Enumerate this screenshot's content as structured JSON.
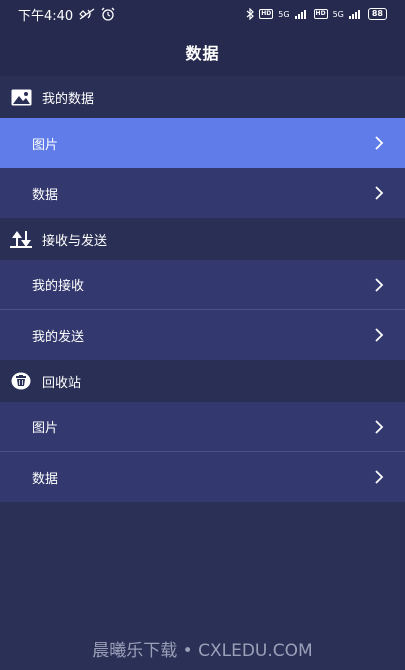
{
  "status_bar": {
    "time": "下午4:40",
    "signal1": "5G",
    "signal2": "5G",
    "hd": "HD",
    "battery": "88"
  },
  "title": "数据",
  "sections": [
    {
      "header": "我的数据",
      "icon": "image-icon",
      "items": [
        {
          "label": "图片",
          "active": true
        },
        {
          "label": "数据",
          "active": false
        }
      ]
    },
    {
      "header": "接收与发送",
      "icon": "transfer-icon",
      "items": [
        {
          "label": "我的接收",
          "active": false
        },
        {
          "label": "我的发送",
          "active": false
        }
      ]
    },
    {
      "header": "回收站",
      "icon": "trash-icon",
      "items": [
        {
          "label": "图片",
          "active": false
        },
        {
          "label": "数据",
          "active": false
        }
      ]
    }
  ],
  "watermark": "晨曦乐下载 • CXLEDU.COM",
  "colors": {
    "background": "#2b3056",
    "row": "#33396e",
    "active": "#5f7ce8",
    "header": "#2a2f55"
  }
}
